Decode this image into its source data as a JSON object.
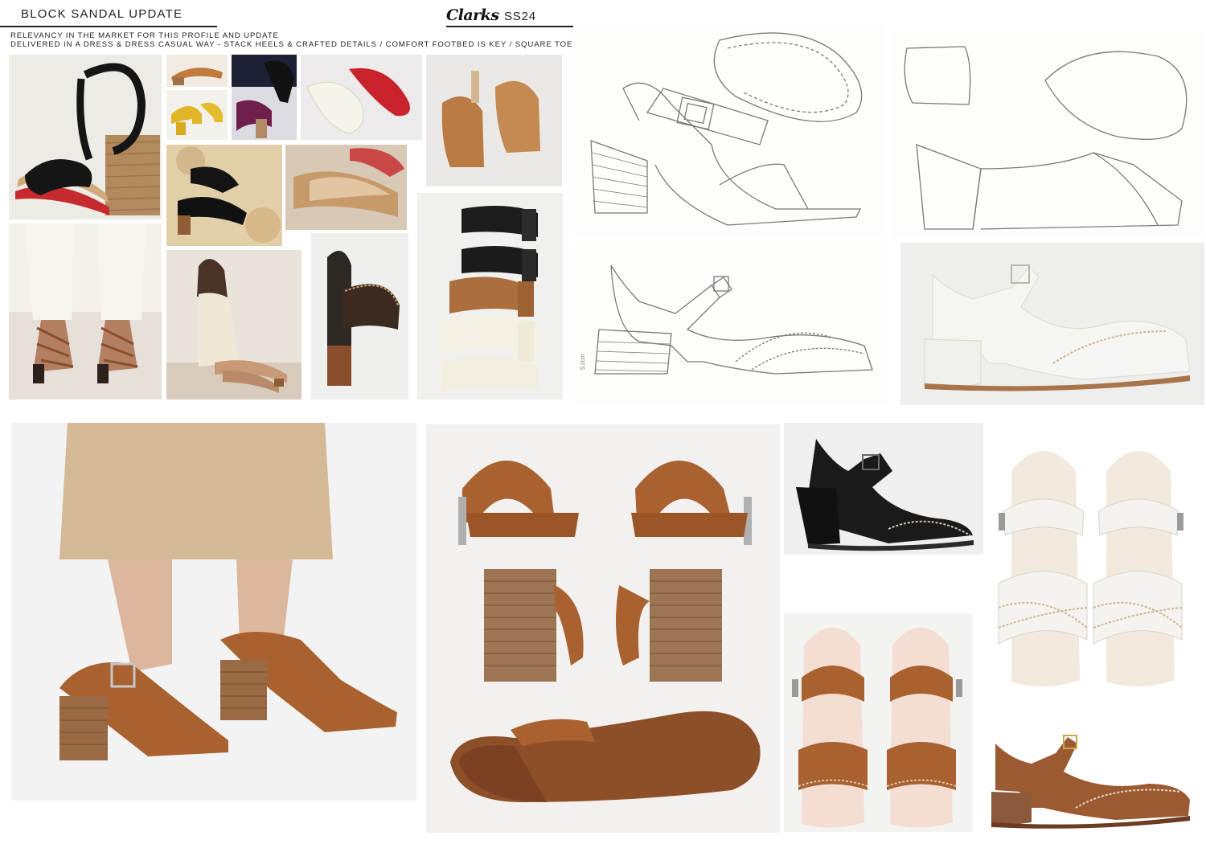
{
  "header": {
    "title": "BLOCK SANDAL UPDATE",
    "brand_logo": "Clarks",
    "brand_season": "SS24",
    "subtitle_1": "RELEVANCY IN THE MARKET FOR THIS PROFILE AND UPDATE",
    "subtitle_2": "DELIVERED IN A DRESS & DRESS CASUAL WAY - STACK HEELS & CRAFTED DETAILS / COMFORT FOOTBED IS KEY / SQUARE TOE SHAPE IS KEY"
  },
  "sketch_note": "5.2cm",
  "colors": {
    "tan_leather": "#a8612f",
    "black_leather": "#1b1b1b",
    "white_leather": "#f1efe9",
    "stack_wood": "#a7784f",
    "red_sole": "#c8232c",
    "pencil": "#7a7a7a"
  }
}
